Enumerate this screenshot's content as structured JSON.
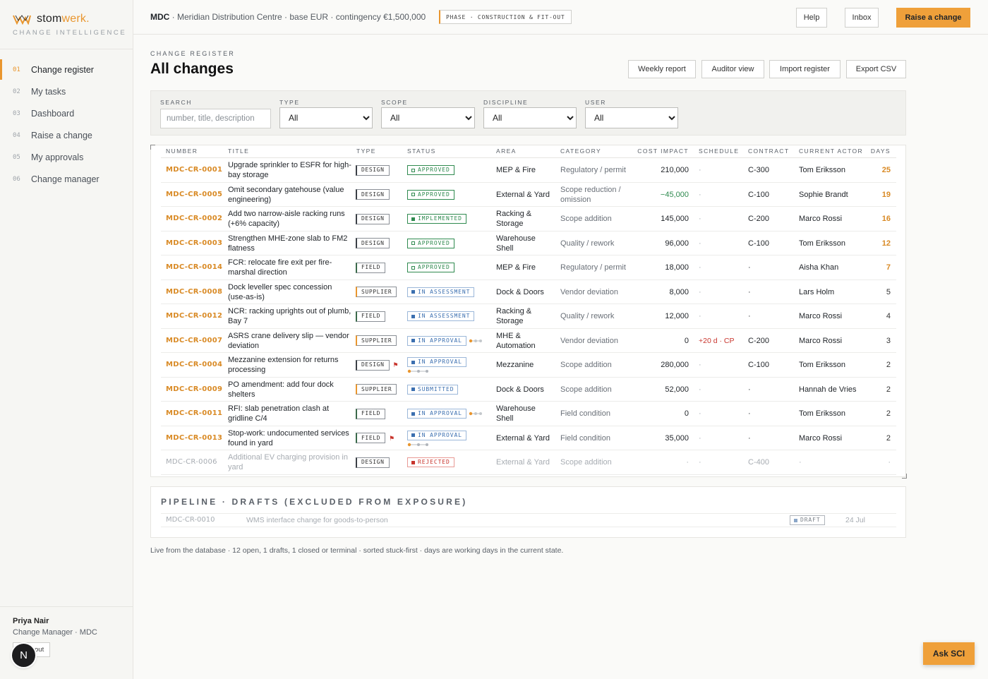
{
  "app": {
    "brand_main": "stom",
    "brand_accent": "werk.",
    "brand_sub": "CHANGE INTELLIGENCE",
    "accent_color": "#e9962e"
  },
  "nav": [
    {
      "num": "01",
      "label": "Change register",
      "active": true
    },
    {
      "num": "02",
      "label": "My tasks"
    },
    {
      "num": "03",
      "label": "Dashboard"
    },
    {
      "num": "04",
      "label": "Raise a change"
    },
    {
      "num": "05",
      "label": "My approvals"
    },
    {
      "num": "06",
      "label": "Change manager"
    }
  ],
  "user": {
    "name": "Priya Nair",
    "role": "Change Manager · MDC",
    "signout_label": "out",
    "avatar_letter": "N"
  },
  "topbar": {
    "project_code": "MDC",
    "project_desc": " · Meridian Distribution Centre · base EUR · contingency €1,500,000",
    "phase_label": "PHASE · CONSTRUCTION & FIT-OUT",
    "help_label": "Help",
    "inbox_label": "Inbox",
    "raise_label": "Raise a change"
  },
  "page": {
    "eyebrow": "CHANGE REGISTER",
    "title": "All changes",
    "actions": [
      "Weekly report",
      "Auditor view",
      "Import register",
      "Export CSV"
    ]
  },
  "filters": {
    "search_label": "SEARCH",
    "search_placeholder": "number, title, description",
    "search_value": "",
    "type_label": "TYPE",
    "type_value": "All",
    "scope_label": "SCOPE",
    "scope_value": "All",
    "discipline_label": "DISCIPLINE",
    "discipline_value": "All",
    "user_label": "USER",
    "user_value": "All"
  },
  "table": {
    "headers": {
      "number": "NUMBER",
      "title": "TITLE",
      "type": "TYPE",
      "status": "STATUS",
      "area": "AREA",
      "category": "CATEGORY",
      "cost": "COST IMPACT",
      "schedule": "SCHEDULE",
      "contract": "CONTRACT",
      "actor": "CURRENT ACTOR",
      "days": "DAYS"
    },
    "rows": [
      {
        "number": "MDC-CR-0001",
        "title": "Upgrade sprinkler to ESFR for high-bay storage",
        "type": "DESIGN",
        "status": "APPROVED",
        "status_kind": "approved",
        "area": "MEP & Fire",
        "category": "Regulatory / permit",
        "cost": "210,000",
        "schedule": "·",
        "contract": "C-300",
        "actor": "Tom Eriksson",
        "days": "25",
        "days_hot": true
      },
      {
        "number": "MDC-CR-0005",
        "title": "Omit secondary gatehouse (value engineering)",
        "type": "DESIGN",
        "status": "APPROVED",
        "status_kind": "approved",
        "area": "External & Yard",
        "category": "Scope reduction / omission",
        "cost": "−45,000",
        "cost_negative": true,
        "schedule": "·",
        "contract": "C-100",
        "actor": "Sophie Brandt",
        "days": "19",
        "days_hot": true
      },
      {
        "number": "MDC-CR-0002",
        "title": "Add two narrow-aisle racking runs (+6% capacity)",
        "type": "DESIGN",
        "status": "IMPLEMENTED",
        "status_kind": "implemented",
        "area": "Racking & Storage",
        "category": "Scope addition",
        "cost": "145,000",
        "schedule": "·",
        "contract": "C-200",
        "actor": "Marco Rossi",
        "days": "16",
        "days_hot": true
      },
      {
        "number": "MDC-CR-0003",
        "title": "Strengthen MHE-zone slab to FM2 flatness",
        "type": "DESIGN",
        "status": "APPROVED",
        "status_kind": "approved",
        "area": "Warehouse Shell",
        "category": "Quality / rework",
        "cost": "96,000",
        "schedule": "·",
        "contract": "C-100",
        "actor": "Tom Eriksson",
        "days": "12",
        "days_hot": true
      },
      {
        "number": "MDC-CR-0014",
        "title": "FCR: relocate fire exit per fire-marshal direction",
        "type": "FIELD",
        "status": "APPROVED",
        "status_kind": "approved",
        "area": "MEP & Fire",
        "category": "Regulatory / permit",
        "cost": "18,000",
        "schedule": "·",
        "contract": "·",
        "actor": "Aisha Khan",
        "days": "7",
        "days_hot": true
      },
      {
        "number": "MDC-CR-0008",
        "title": "Dock leveller spec concession (use-as-is)",
        "type": "SUPPLIER",
        "status": "IN ASSESSMENT",
        "status_kind": "assess",
        "area": "Dock & Doors",
        "category": "Vendor deviation",
        "cost": "8,000",
        "schedule": "·",
        "contract": "·",
        "actor": "Lars Holm",
        "days": "5"
      },
      {
        "number": "MDC-CR-0012",
        "title": "NCR: racking uprights out of plumb, Bay 7",
        "type": "FIELD",
        "status": "IN ASSESSMENT",
        "status_kind": "assess",
        "area": "Racking & Storage",
        "category": "Quality / rework",
        "cost": "12,000",
        "schedule": "·",
        "contract": "·",
        "actor": "Marco Rossi",
        "days": "4"
      },
      {
        "number": "MDC-CR-0007",
        "title": "ASRS crane delivery slip — vendor deviation",
        "type": "SUPPLIER",
        "status": "IN APPROVAL",
        "status_kind": "approval",
        "progress_inline": true,
        "area": "MHE & Automation",
        "category": "Vendor deviation",
        "cost": "0",
        "schedule": "+20 d · CP",
        "schedule_hot": true,
        "contract": "C-200",
        "actor": "Marco Rossi",
        "days": "3"
      },
      {
        "number": "MDC-CR-0004",
        "title": "Mezzanine extension for returns processing",
        "type": "DESIGN",
        "flag": true,
        "status": "IN APPROVAL",
        "status_kind": "approval",
        "progress_below": true,
        "area": "Mezzanine",
        "category": "Scope addition",
        "cost": "280,000",
        "schedule": "·",
        "contract": "C-100",
        "actor": "Tom Eriksson",
        "days": "2"
      },
      {
        "number": "MDC-CR-0009",
        "title": "PO amendment: add four dock shelters",
        "type": "SUPPLIER",
        "status": "SUBMITTED",
        "status_kind": "submitted",
        "area": "Dock & Doors",
        "category": "Scope addition",
        "cost": "52,000",
        "schedule": "·",
        "contract": "·",
        "actor": "Hannah de Vries",
        "days": "2"
      },
      {
        "number": "MDC-CR-0011",
        "title": "RFI: slab penetration clash at gridline C/4",
        "type": "FIELD",
        "status": "IN APPROVAL",
        "status_kind": "approval",
        "progress_inline": true,
        "area": "Warehouse Shell",
        "category": "Field condition",
        "cost": "0",
        "schedule": "·",
        "contract": "·",
        "actor": "Tom Eriksson",
        "days": "2"
      },
      {
        "number": "MDC-CR-0013",
        "title": "Stop-work: undocumented services found in yard",
        "type": "FIELD",
        "flag": true,
        "status": "IN APPROVAL",
        "status_kind": "approval",
        "progress_below": true,
        "area": "External & Yard",
        "category": "Field condition",
        "cost": "35,000",
        "schedule": "·",
        "contract": "·",
        "actor": "Marco Rossi",
        "days": "2"
      },
      {
        "number": "MDC-CR-0006",
        "title": "Additional EV charging provision in yard",
        "type": "DESIGN",
        "status": "REJECTED",
        "status_kind": "rejected",
        "muted": true,
        "area": "External & Yard",
        "category": "Scope addition",
        "cost": "·",
        "schedule": "·",
        "contract": "C-400",
        "actor": "·",
        "days": "·"
      }
    ]
  },
  "pipeline": {
    "title": "PIPELINE · DRAFTS (EXCLUDED FROM EXPOSURE)",
    "rows": [
      {
        "number": "MDC-CR-0010",
        "title": "WMS interface change for goods-to-person",
        "status": "DRAFT",
        "date": "24 Jul"
      }
    ]
  },
  "footer_note": "Live from the database · 12 open, 1 drafts, 1 closed or terminal · sorted stuck-first · days are working days in the current state.",
  "ask_label": "Ask SCI"
}
